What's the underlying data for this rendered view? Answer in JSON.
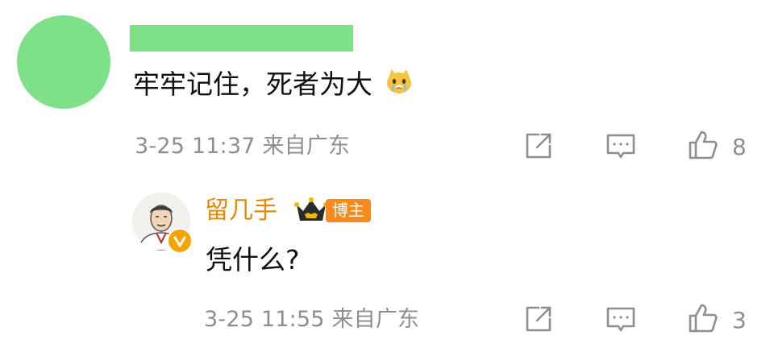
{
  "colors": {
    "redaction_green": "#7ee087",
    "meta_gray": "#8e8e8e",
    "blogger_orange": "#e58a00",
    "badge_orange": "#f58b1f"
  },
  "comment": {
    "text": "牢牢记住，死者为大",
    "emoji": "crying-dog-emoji",
    "meta": "3-25 11:37 来自广东",
    "like_count": "8"
  },
  "reply": {
    "author": "留几手",
    "badge_label": "博主",
    "text": "凭什么?",
    "meta": "3-25 11:55 来自广东",
    "like_count": "3"
  }
}
